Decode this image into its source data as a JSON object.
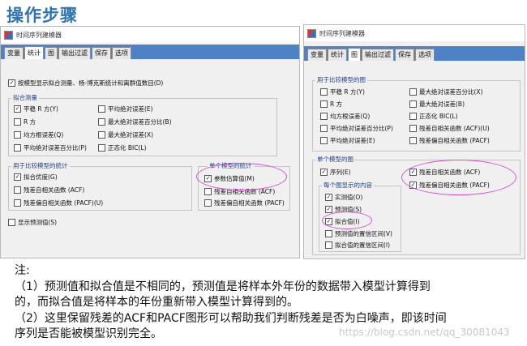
{
  "page": {
    "title": "操作步骤"
  },
  "left_dialog": {
    "title": "时间序列建模器",
    "tabs": [
      "变量",
      "统计",
      "图",
      "输出过滤",
      "保存",
      "选项"
    ],
    "active_tab": "统计",
    "display_fit_option": "按模型显示拟合测量、杨-博克斯统计和离群值数目(D)",
    "fit_measures": {
      "label": "拟合测量",
      "items": [
        {
          "label": "平稳 R 方(Y)",
          "checked": true
        },
        {
          "label": "平均绝对误差(E)",
          "checked": false
        },
        {
          "label": "R 方",
          "checked": false
        },
        {
          "label": "最大绝对误差百分比(B)",
          "checked": false
        },
        {
          "label": "均方根误差(Q)",
          "checked": false
        },
        {
          "label": "最大绝对误差(X)",
          "checked": false
        },
        {
          "label": "平均绝对误差百分比(P)",
          "checked": false
        },
        {
          "label": "正态化 BIC(L)",
          "checked": false
        }
      ]
    },
    "compare_stats": {
      "label": "用于比较模型的统计",
      "items": [
        {
          "label": "拟合优度(G)",
          "checked": true
        },
        {
          "label": "残差自相关函数 (ACF)",
          "checked": false
        },
        {
          "label": "残差偏自相关函数 (PACF)(U)",
          "checked": false
        }
      ]
    },
    "single_stats": {
      "label": "单个模型的统计",
      "items": [
        {
          "label": "参数估算值(M)",
          "checked": true
        },
        {
          "label": "残差自相关函数 (ACF)",
          "checked": false
        },
        {
          "label": "残差偏自相关函数 (PACF)",
          "checked": false
        }
      ]
    },
    "show_forecast": {
      "label": "显示预测值(S)",
      "checked": false
    }
  },
  "right_dialog": {
    "title": "时间序列建模器",
    "tabs": [
      "变量",
      "统计",
      "图",
      "输出过滤",
      "保存",
      "选项"
    ],
    "active_tab": "图",
    "compare_plots": {
      "label": "用于比较模型的图",
      "items": [
        {
          "label": "平稳 R 方(Y)",
          "checked": false
        },
        {
          "label": "最大绝对误差百分比(X)",
          "checked": false
        },
        {
          "label": "R 方",
          "checked": false
        },
        {
          "label": "最大绝对误差(B)",
          "checked": false
        },
        {
          "label": "均方根误差(Q)",
          "checked": false
        },
        {
          "label": "正态化 BIC(L)",
          "checked": false
        },
        {
          "label": "平均绝对误差百分比(P)",
          "checked": false
        },
        {
          "label": "残差自相关函数 (ACF)(U)",
          "checked": false
        },
        {
          "label": "平均绝对误差(E)",
          "checked": false
        },
        {
          "label": "残差偏自相关函数 (PACF)",
          "checked": false
        }
      ]
    },
    "single_plots": {
      "label": "单个模型的图",
      "series": {
        "label": "序列(E)",
        "checked": true
      },
      "acf": {
        "label": "残差自相关函数 (ACF)",
        "checked": true
      },
      "pacf": {
        "label": "残差偏自相关函数 (PACF)",
        "checked": true
      },
      "per_plot": {
        "label": "每个图显示的内容",
        "items": [
          {
            "label": "实测值(O)",
            "checked": true
          },
          {
            "label": "预测值(S)",
            "checked": true
          },
          {
            "label": "拟合值(I)",
            "checked": true
          },
          {
            "label": "预测值的置信区间(V)",
            "checked": false
          },
          {
            "label": "拟合值的置信区间(I)",
            "checked": false
          }
        ]
      }
    }
  },
  "notes": {
    "heading": "注:",
    "line1": "（1）预测值和拟合值是不相同的，预测值是将样本外年份的数据带入模型计算得到",
    "line2": "的，而拟合值是将样本的年份重新带入模型计算得到的。",
    "line3": "（2）这里保留残差的ACF和PACF图形可以帮助我们判断残差是否为白噪声，即该时间",
    "line4": "序列是否能被模型识别完全。"
  },
  "watermark": "https://blog.csdn.net/qq_30081043"
}
